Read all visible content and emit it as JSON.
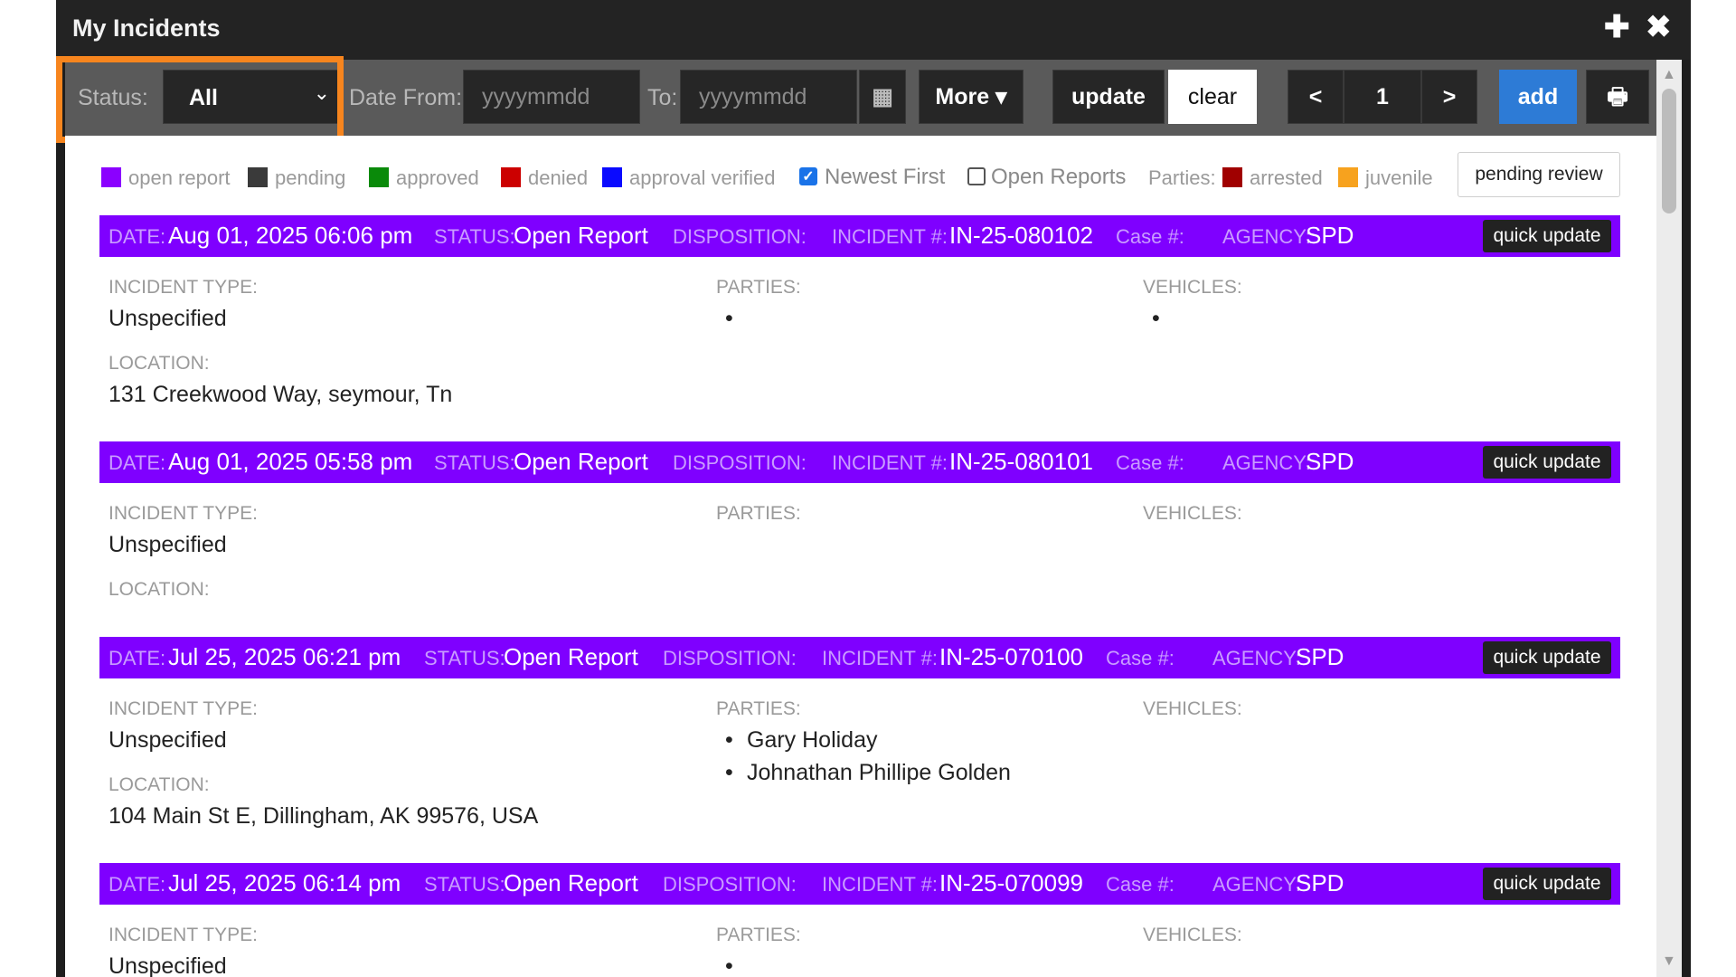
{
  "window": {
    "title": "My Incidents"
  },
  "toolbar": {
    "status_label": "Status:",
    "status_value": "All",
    "date_from_label": "Date From:",
    "date_from_placeholder": "yyyymmdd",
    "to_label": "To:",
    "to_placeholder": "yyyymmdd",
    "more_label": "More ▾",
    "update_label": "update",
    "clear_label": "clear",
    "prev_label": "<",
    "page_number": "1",
    "next_label": ">",
    "add_label": "add"
  },
  "legend": {
    "items": [
      {
        "label": "open report",
        "color": "#8b00ff"
      },
      {
        "label": "pending",
        "color": "#3a3a3a"
      },
      {
        "label": "approved",
        "color": "#0a8a0a"
      },
      {
        "label": "denied",
        "color": "#cc0000"
      },
      {
        "label": "approval verified",
        "color": "#0a0aff"
      }
    ],
    "newest_first": "Newest First",
    "open_reports": "Open Reports",
    "parties_label": "Parties:",
    "arrested": {
      "label": "arrested",
      "color": "#a00000"
    },
    "juvenile": {
      "label": "juvenile",
      "color": "#f7a21e"
    },
    "pending_review": "pending review"
  },
  "labels": {
    "date": "DATE:",
    "status": "STATUS:",
    "disposition": "DISPOSITION:",
    "incident": "INCIDENT #:",
    "case": "Case #:",
    "agency": "AGENCY:",
    "incident_type": "INCIDENT TYPE:",
    "parties": "PARTIES:",
    "vehicles": "VEHICLES:",
    "location": "LOCATION:",
    "quick_update": "quick update"
  },
  "incidents": [
    {
      "date": "Aug 01, 2025 06:06 pm",
      "status": "Open Report",
      "incident_no": "IN-25-080102",
      "agency": "SPD",
      "incident_type": "Unspecified",
      "location": "131 Creekwood Way, seymour, Tn",
      "parties": [
        "•"
      ],
      "vehicles": [
        "•"
      ]
    },
    {
      "date": "Aug 01, 2025 05:58 pm",
      "status": "Open Report",
      "incident_no": "IN-25-080101",
      "agency": "SPD",
      "incident_type": "Unspecified",
      "location": "",
      "parties": [],
      "vehicles": []
    },
    {
      "date": "Jul 25, 2025 06:21 pm",
      "status": "Open Report",
      "incident_no": "IN-25-070100",
      "agency": "SPD",
      "incident_type": "Unspecified",
      "location": "104 Main St E, Dillingham, AK 99576, USA",
      "parties": [
        "Gary Holiday",
        "Johnathan Phillipe Golden"
      ],
      "vehicles": []
    },
    {
      "date": "Jul 25, 2025 06:14 pm",
      "status": "Open Report",
      "incident_no": "IN-25-070099",
      "agency": "SPD",
      "incident_type": "Unspecified",
      "location": "",
      "parties": [
        "•"
      ],
      "vehicles": []
    }
  ]
}
